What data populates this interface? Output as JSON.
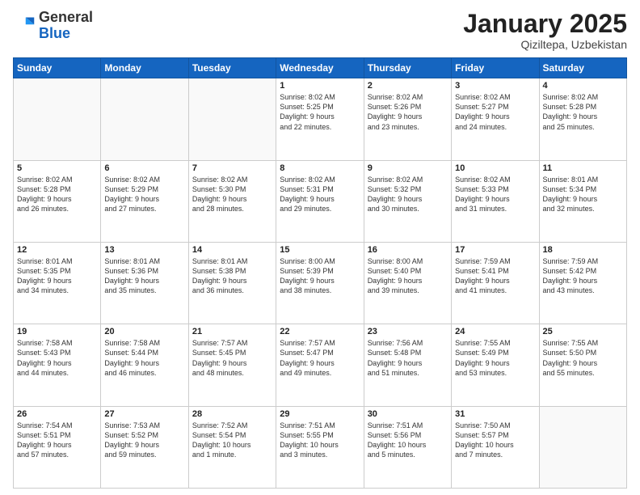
{
  "header": {
    "logo_general": "General",
    "logo_blue": "Blue",
    "month_title": "January 2025",
    "location": "Qiziltepa, Uzbekistan"
  },
  "days_of_week": [
    "Sunday",
    "Monday",
    "Tuesday",
    "Wednesday",
    "Thursday",
    "Friday",
    "Saturday"
  ],
  "weeks": [
    [
      {
        "day": "",
        "info": ""
      },
      {
        "day": "",
        "info": ""
      },
      {
        "day": "",
        "info": ""
      },
      {
        "day": "1",
        "info": "Sunrise: 8:02 AM\nSunset: 5:25 PM\nDaylight: 9 hours\nand 22 minutes."
      },
      {
        "day": "2",
        "info": "Sunrise: 8:02 AM\nSunset: 5:26 PM\nDaylight: 9 hours\nand 23 minutes."
      },
      {
        "day": "3",
        "info": "Sunrise: 8:02 AM\nSunset: 5:27 PM\nDaylight: 9 hours\nand 24 minutes."
      },
      {
        "day": "4",
        "info": "Sunrise: 8:02 AM\nSunset: 5:28 PM\nDaylight: 9 hours\nand 25 minutes."
      }
    ],
    [
      {
        "day": "5",
        "info": "Sunrise: 8:02 AM\nSunset: 5:28 PM\nDaylight: 9 hours\nand 26 minutes."
      },
      {
        "day": "6",
        "info": "Sunrise: 8:02 AM\nSunset: 5:29 PM\nDaylight: 9 hours\nand 27 minutes."
      },
      {
        "day": "7",
        "info": "Sunrise: 8:02 AM\nSunset: 5:30 PM\nDaylight: 9 hours\nand 28 minutes."
      },
      {
        "day": "8",
        "info": "Sunrise: 8:02 AM\nSunset: 5:31 PM\nDaylight: 9 hours\nand 29 minutes."
      },
      {
        "day": "9",
        "info": "Sunrise: 8:02 AM\nSunset: 5:32 PM\nDaylight: 9 hours\nand 30 minutes."
      },
      {
        "day": "10",
        "info": "Sunrise: 8:02 AM\nSunset: 5:33 PM\nDaylight: 9 hours\nand 31 minutes."
      },
      {
        "day": "11",
        "info": "Sunrise: 8:01 AM\nSunset: 5:34 PM\nDaylight: 9 hours\nand 32 minutes."
      }
    ],
    [
      {
        "day": "12",
        "info": "Sunrise: 8:01 AM\nSunset: 5:35 PM\nDaylight: 9 hours\nand 34 minutes."
      },
      {
        "day": "13",
        "info": "Sunrise: 8:01 AM\nSunset: 5:36 PM\nDaylight: 9 hours\nand 35 minutes."
      },
      {
        "day": "14",
        "info": "Sunrise: 8:01 AM\nSunset: 5:38 PM\nDaylight: 9 hours\nand 36 minutes."
      },
      {
        "day": "15",
        "info": "Sunrise: 8:00 AM\nSunset: 5:39 PM\nDaylight: 9 hours\nand 38 minutes."
      },
      {
        "day": "16",
        "info": "Sunrise: 8:00 AM\nSunset: 5:40 PM\nDaylight: 9 hours\nand 39 minutes."
      },
      {
        "day": "17",
        "info": "Sunrise: 7:59 AM\nSunset: 5:41 PM\nDaylight: 9 hours\nand 41 minutes."
      },
      {
        "day": "18",
        "info": "Sunrise: 7:59 AM\nSunset: 5:42 PM\nDaylight: 9 hours\nand 43 minutes."
      }
    ],
    [
      {
        "day": "19",
        "info": "Sunrise: 7:58 AM\nSunset: 5:43 PM\nDaylight: 9 hours\nand 44 minutes."
      },
      {
        "day": "20",
        "info": "Sunrise: 7:58 AM\nSunset: 5:44 PM\nDaylight: 9 hours\nand 46 minutes."
      },
      {
        "day": "21",
        "info": "Sunrise: 7:57 AM\nSunset: 5:45 PM\nDaylight: 9 hours\nand 48 minutes."
      },
      {
        "day": "22",
        "info": "Sunrise: 7:57 AM\nSunset: 5:47 PM\nDaylight: 9 hours\nand 49 minutes."
      },
      {
        "day": "23",
        "info": "Sunrise: 7:56 AM\nSunset: 5:48 PM\nDaylight: 9 hours\nand 51 minutes."
      },
      {
        "day": "24",
        "info": "Sunrise: 7:55 AM\nSunset: 5:49 PM\nDaylight: 9 hours\nand 53 minutes."
      },
      {
        "day": "25",
        "info": "Sunrise: 7:55 AM\nSunset: 5:50 PM\nDaylight: 9 hours\nand 55 minutes."
      }
    ],
    [
      {
        "day": "26",
        "info": "Sunrise: 7:54 AM\nSunset: 5:51 PM\nDaylight: 9 hours\nand 57 minutes."
      },
      {
        "day": "27",
        "info": "Sunrise: 7:53 AM\nSunset: 5:52 PM\nDaylight: 9 hours\nand 59 minutes."
      },
      {
        "day": "28",
        "info": "Sunrise: 7:52 AM\nSunset: 5:54 PM\nDaylight: 10 hours\nand 1 minute."
      },
      {
        "day": "29",
        "info": "Sunrise: 7:51 AM\nSunset: 5:55 PM\nDaylight: 10 hours\nand 3 minutes."
      },
      {
        "day": "30",
        "info": "Sunrise: 7:51 AM\nSunset: 5:56 PM\nDaylight: 10 hours\nand 5 minutes."
      },
      {
        "day": "31",
        "info": "Sunrise: 7:50 AM\nSunset: 5:57 PM\nDaylight: 10 hours\nand 7 minutes."
      },
      {
        "day": "",
        "info": ""
      }
    ]
  ]
}
